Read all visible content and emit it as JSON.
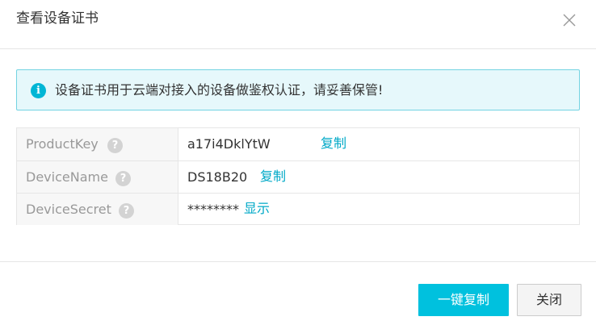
{
  "dialog": {
    "title": "查看设备证书",
    "close_icon": "close-icon"
  },
  "alert": {
    "icon": "info-icon",
    "icon_glyph": "i",
    "text": "设备证书用于云端对接入的设备做鉴权认证，请妥善保管!"
  },
  "rows": [
    {
      "key": "ProductKey",
      "help": "?",
      "value": "a17i4DklYtW",
      "action": "复制"
    },
    {
      "key": "DeviceName",
      "help": "?",
      "value": "DS18B20",
      "action": "复制"
    },
    {
      "key": "DeviceSecret",
      "help": "?",
      "value": "********",
      "action": "显示"
    }
  ],
  "footer": {
    "copy_all_label": "一键复制",
    "close_label": "关闭"
  },
  "colors": {
    "accent": "#00c1de",
    "link": "#00a9c7",
    "alert_bg": "#e6f8fb",
    "alert_border": "#73d3e2"
  }
}
